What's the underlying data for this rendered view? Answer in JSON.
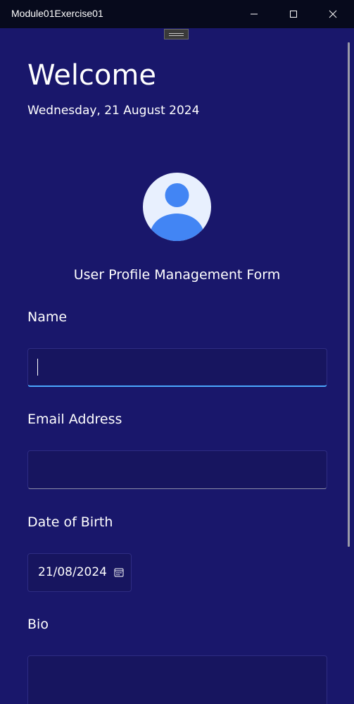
{
  "window": {
    "title": "Module01Exercise01",
    "minimize_icon": "minimize-icon",
    "maximize_icon": "maximize-icon",
    "close_icon": "close-icon"
  },
  "header": {
    "welcome": "Welcome",
    "date": "Wednesday, 21 August 2024"
  },
  "avatar": {
    "icon": "user-avatar-icon",
    "bg_color": "#e8f0fe",
    "fg_color": "#4285f4"
  },
  "form": {
    "title": "User Profile Management Form",
    "name": {
      "label": "Name",
      "value": "",
      "placeholder": ""
    },
    "email": {
      "label": "Email Address",
      "value": "",
      "placeholder": ""
    },
    "dob": {
      "label": "Date of Birth",
      "value": "21/08/2024",
      "icon": "calendar-icon"
    },
    "bio": {
      "label": "Bio",
      "value": ""
    }
  },
  "colors": {
    "background": "#19176b",
    "titlebar": "#070a1c",
    "focus_accent": "#4aa7ff"
  }
}
